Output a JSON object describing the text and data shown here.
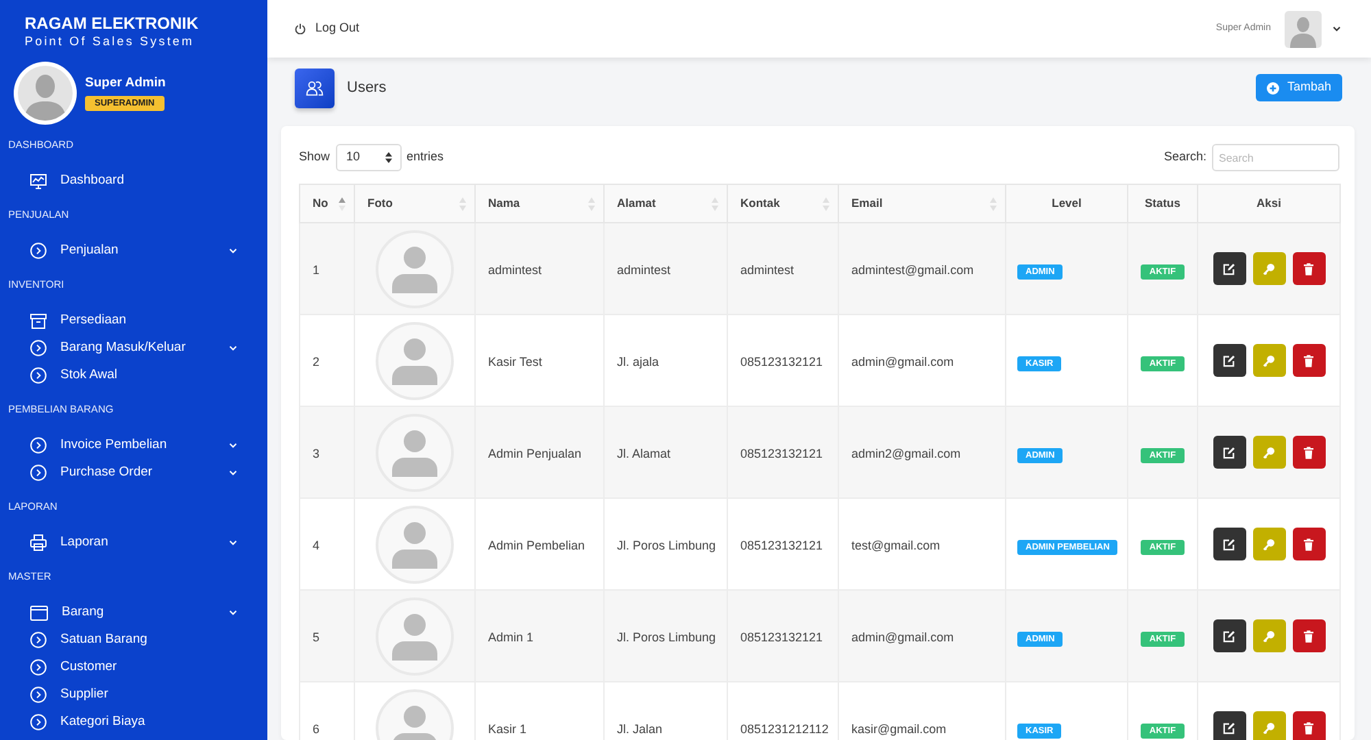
{
  "sidebar": {
    "brand": {
      "title": "RAGAM ELEKTRONIK",
      "subtitle": "Point Of Sales System"
    },
    "user": {
      "name": "Super Admin",
      "role": "SUPERADMIN"
    },
    "sections": [
      {
        "label": "DASHBOARD",
        "items": [
          {
            "label": "Dashboard",
            "kind": "monitor",
            "has_submenu": false
          }
        ]
      },
      {
        "label": "PENJUALAN",
        "items": [
          {
            "label": "Penjualan",
            "kind": "circle_arrow",
            "has_submenu": true
          }
        ]
      },
      {
        "label": "INVENTORI",
        "items": [
          {
            "label": "Persediaan",
            "kind": "archive",
            "has_submenu": false
          },
          {
            "label": "Barang Masuk/Keluar",
            "kind": "circle_arrow",
            "has_submenu": true
          },
          {
            "label": "Stok Awal",
            "kind": "circle_arrow",
            "has_submenu": false
          }
        ]
      },
      {
        "label": "PEMBELIAN BARANG",
        "items": [
          {
            "label": "Invoice Pembelian",
            "kind": "circle_arrow",
            "has_submenu": true
          },
          {
            "label": "Purchase Order",
            "kind": "circle_arrow",
            "has_submenu": true
          }
        ]
      },
      {
        "label": "LAPORAN",
        "items": [
          {
            "label": "Laporan",
            "kind": "printer",
            "has_submenu": true
          }
        ]
      },
      {
        "label": "MASTER",
        "items": [
          {
            "label": "Barang",
            "kind": "window",
            "has_submenu": true
          },
          {
            "label": "Satuan Barang",
            "kind": "circle_arrow",
            "has_submenu": false
          },
          {
            "label": "Customer",
            "kind": "circle_arrow",
            "has_submenu": false
          },
          {
            "label": "Supplier",
            "kind": "circle_arrow",
            "has_submenu": false
          },
          {
            "label": "Kategori Biaya",
            "kind": "circle_arrow",
            "has_submenu": false
          }
        ]
      }
    ]
  },
  "topbar": {
    "logout": "Log Out",
    "user_name": "Super Admin"
  },
  "page_header": {
    "title": "Users",
    "add_button": "Tambah"
  },
  "table_controls": {
    "show_label": "Show",
    "page_size": "10",
    "entries_label": "entries",
    "search_label": "Search:",
    "search_placeholder": "Search"
  },
  "table": {
    "columns": [
      {
        "label": "No",
        "sortable": true,
        "sorted": true
      },
      {
        "label": "Foto",
        "sortable": true,
        "sorted": false
      },
      {
        "label": "Nama",
        "sortable": true,
        "sorted": false
      },
      {
        "label": "Alamat",
        "sortable": true,
        "sorted": false
      },
      {
        "label": "Kontak",
        "sortable": true,
        "sorted": false
      },
      {
        "label": "Email",
        "sortable": true,
        "sorted": false
      },
      {
        "label": "Level",
        "sortable": false,
        "sorted": false
      },
      {
        "label": "Status",
        "sortable": false,
        "sorted": false
      },
      {
        "label": "Aksi",
        "sortable": false,
        "sorted": false
      }
    ],
    "rows": [
      {
        "no": "1",
        "name": "admintest",
        "address": "admintest",
        "contact": "admintest",
        "email": "admintest@gmail.com",
        "level": "ADMIN",
        "status": "AKTIF"
      },
      {
        "no": "2",
        "name": "Kasir Test",
        "address": "Jl. ajala",
        "contact": "085123132121",
        "email": "admin@gmail.com",
        "level": "KASIR",
        "status": "AKTIF"
      },
      {
        "no": "3",
        "name": "Admin Penjualan",
        "address": "Jl. Alamat",
        "contact": "085123132121",
        "email": "admin2@gmail.com",
        "level": "ADMIN",
        "status": "AKTIF"
      },
      {
        "no": "4",
        "name": "Admin Pembelian",
        "address": "Jl. Poros Limbung",
        "contact": "085123132121",
        "email": "test@gmail.com",
        "level": "ADMIN PEMBELIAN",
        "status": "AKTIF"
      },
      {
        "no": "5",
        "name": "Admin 1",
        "address": "Jl. Poros Limbung",
        "contact": "085123132121",
        "email": "admin@gmail.com",
        "level": "ADMIN",
        "status": "AKTIF"
      },
      {
        "no": "6",
        "name": "Kasir 1",
        "address": "Jl. Jalan",
        "contact": "0851231212112",
        "email": "kasir@gmail.com",
        "level": "KASIR",
        "status": "AKTIF"
      }
    ]
  }
}
